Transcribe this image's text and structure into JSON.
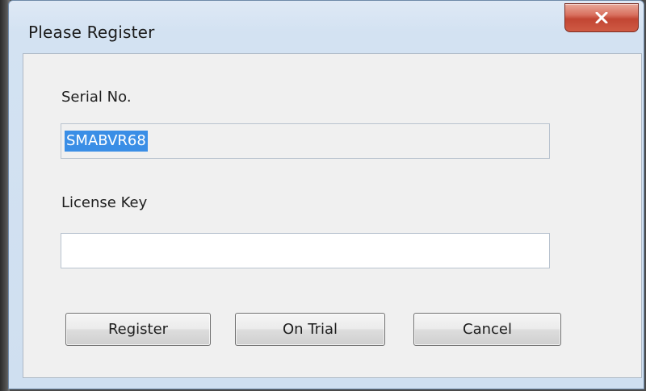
{
  "window": {
    "title": "Please Register"
  },
  "icons": {
    "close": "close-icon"
  },
  "form": {
    "serial_label": "Serial No.",
    "serial_value": "SMABVR68",
    "license_label": "License Key",
    "license_value": ""
  },
  "buttons": {
    "register": "Register",
    "trial": "On Trial",
    "cancel": "Cancel"
  },
  "colors": {
    "selection": "#3a8ee6",
    "close_button": "#c24633"
  }
}
